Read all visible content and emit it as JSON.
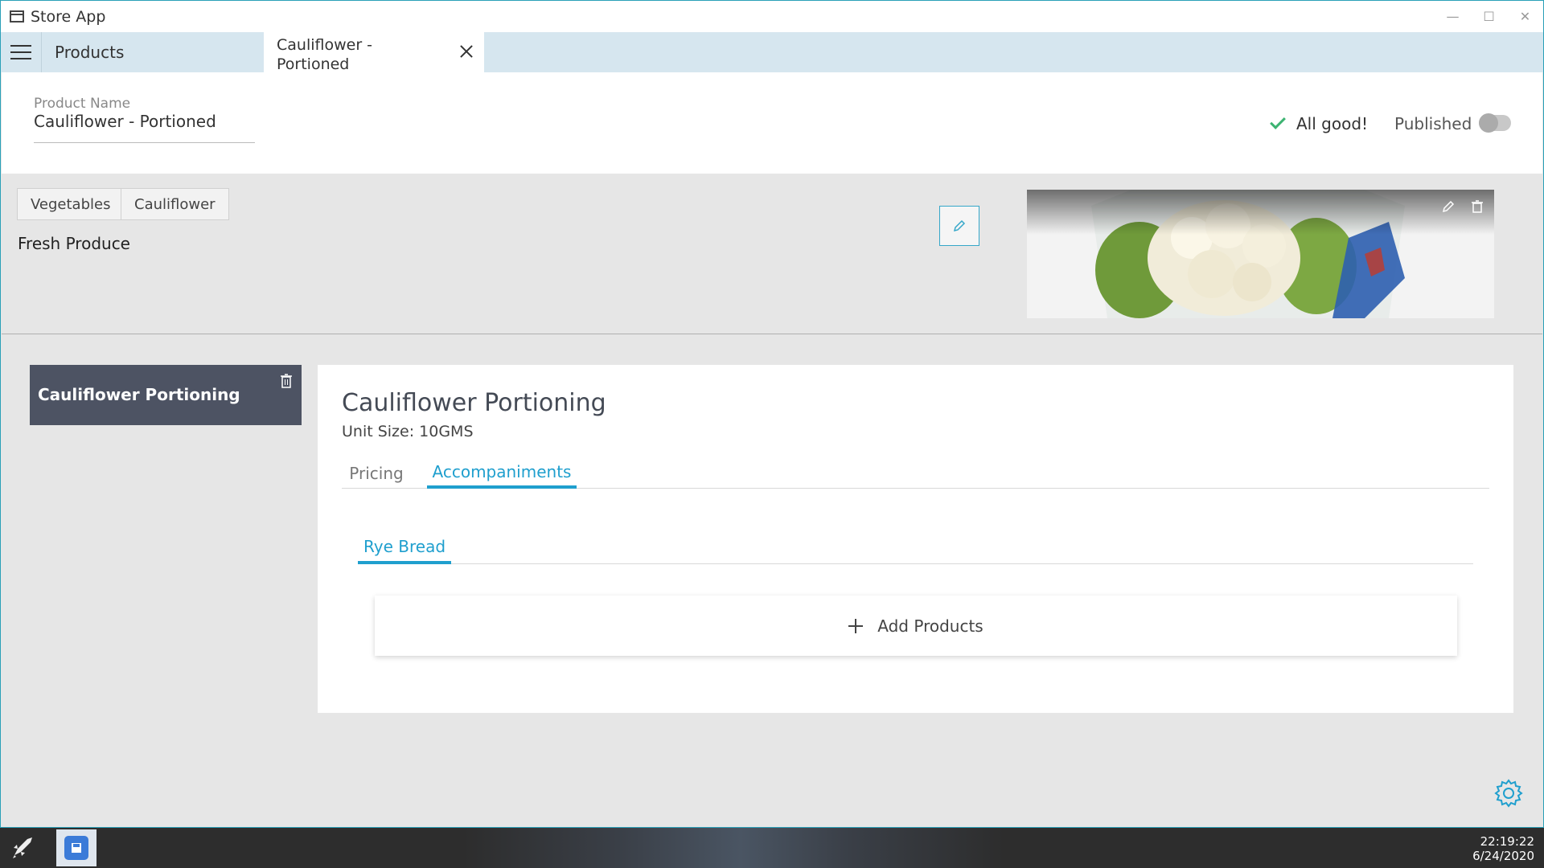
{
  "window": {
    "title": "Store App",
    "minimize_glyph": "—",
    "maximize_glyph": "☐",
    "close_glyph": "✕"
  },
  "tabs": {
    "products_label": "Products",
    "active_label_line1": "Cauliflower -",
    "active_label_line2": "Portioned"
  },
  "header": {
    "product_name_label": "Product Name",
    "product_name_value": "Cauliflower - Portioned",
    "status_text": "All good!",
    "published_label": "Published",
    "published": false
  },
  "category": {
    "chips": [
      "Vegetables",
      "Cauliflower"
    ],
    "group": "Fresh Produce"
  },
  "variant": {
    "card_title": "Cauliflower Portioning",
    "detail_title": "Cauliflower Portioning",
    "unit_size": "Unit Size: 10GMS",
    "tabs": [
      "Pricing",
      "Accompaniments"
    ],
    "active_tab": "Accompaniments",
    "subtabs": [
      "Rye Bread"
    ],
    "add_products_label": "Add Products"
  },
  "taskbar": {
    "time": "22:19:22",
    "date": "6/24/2020"
  },
  "colors": {
    "accent": "#1f9fce",
    "variant_card": "#4d5363",
    "status_ok": "#3cb371",
    "tabbar": "#d6e6ef"
  }
}
